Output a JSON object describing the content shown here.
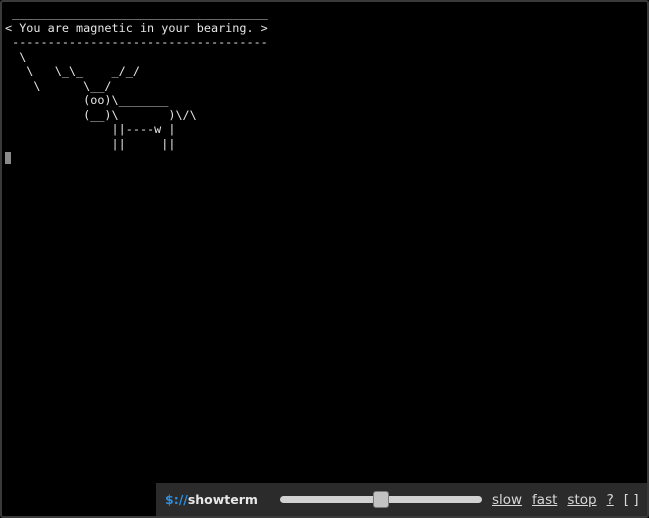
{
  "terminal": {
    "lines": [
      " ____________________________________",
      "< You are magnetic in your bearing. >",
      " ------------------------------------",
      "  \\",
      "   \\   \\_\\_    _/_/",
      "    \\      \\__/",
      "           (oo)\\_______",
      "           (__)\\       )\\/\\",
      "               ||----w |",
      "               ||     ||"
    ]
  },
  "controls": {
    "brand_prefix": "$://",
    "brand_name": "showterm",
    "speed": 0.5,
    "slow_label": "slow",
    "fast_label": "fast",
    "stop_label": "stop",
    "help_label": "?",
    "fullscreen_label": "[ ]"
  }
}
